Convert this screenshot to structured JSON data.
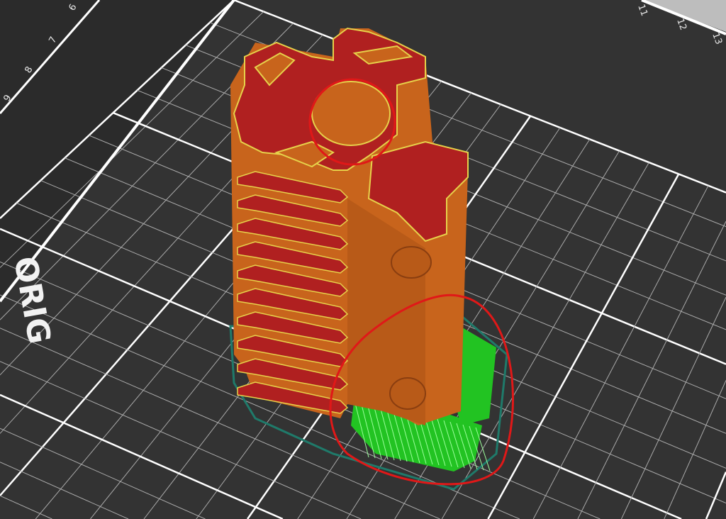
{
  "app": "slicer-preview",
  "bed": {
    "left_ruler_labels": [
      "6",
      "7",
      "8",
      "9"
    ],
    "top_ruler_labels": [
      "11",
      "12",
      "13"
    ],
    "logo_text": "ORIG"
  },
  "colors": {
    "background": "#2b2b2b",
    "bed": "#333333",
    "grid": "#cfcfcf",
    "perimeter": "#d2691e",
    "top_infill": "#b22222",
    "support": "#22c322",
    "skirt": "#1f7a6a",
    "annotation": "#e01818"
  }
}
